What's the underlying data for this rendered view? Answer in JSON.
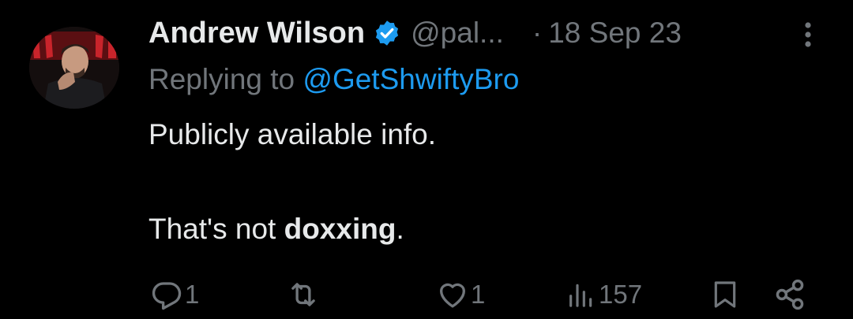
{
  "author": {
    "display_name": "Andrew Wilson",
    "handle": "@pal...",
    "separator": "·",
    "date": "18 Sep 23"
  },
  "reply": {
    "prefix": "Replying to",
    "mention": "@GetShwiftyBro"
  },
  "content": {
    "line1": "Publicly available info.",
    "line2_prefix": "That's not ",
    "line2_bold": "doxxing",
    "line2_suffix": "."
  },
  "actions": {
    "replies": "1",
    "reposts": "",
    "likes": "1",
    "views": "157"
  },
  "icons": {
    "verified": "verified-badge-icon",
    "more": "more-vertical-icon",
    "reply": "reply-icon",
    "repost": "repost-icon",
    "like": "heart-icon",
    "views": "views-icon",
    "bookmark": "bookmark-icon",
    "share": "share-icon"
  },
  "colors": {
    "background": "#000000",
    "text": "#e7e9ea",
    "muted": "#71767b",
    "accent": "#1d9bf0"
  }
}
